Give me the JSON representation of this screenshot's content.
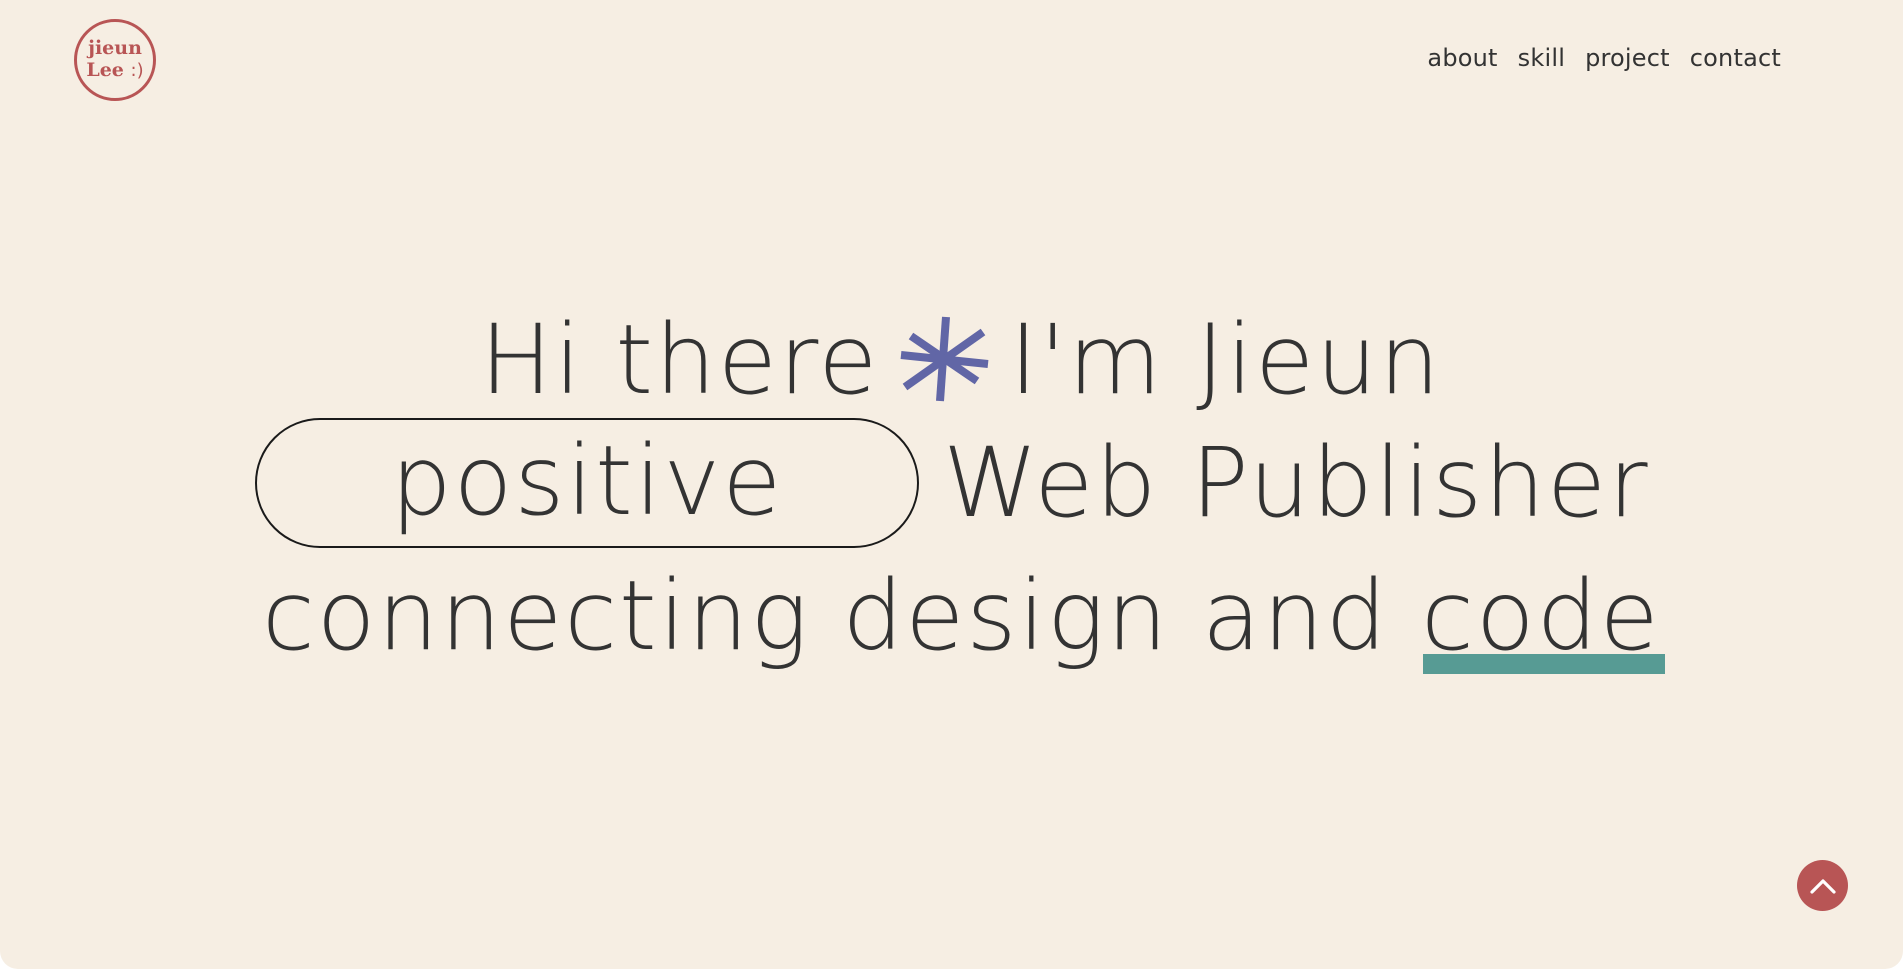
{
  "logo": {
    "line1": "jieun",
    "line2": "Lee",
    "smile": ":)"
  },
  "nav": {
    "items": [
      "about",
      "skill",
      "project",
      "contact"
    ]
  },
  "hero": {
    "line1_before": "Hi there",
    "star_icon": "asterisk-star-icon",
    "line1_after": "I'm Jieun",
    "line2_pill": "positive",
    "line2_after": "Web Publisher",
    "line3_before": "connecting design and",
    "line3_highlight": "code"
  },
  "scroll_top_icon": "chevron-up-icon",
  "colors": {
    "background": "#f6eee3",
    "text": "#333333",
    "accent_red": "#b85555",
    "accent_purple": "#6166a6",
    "accent_teal": "#579b94"
  }
}
